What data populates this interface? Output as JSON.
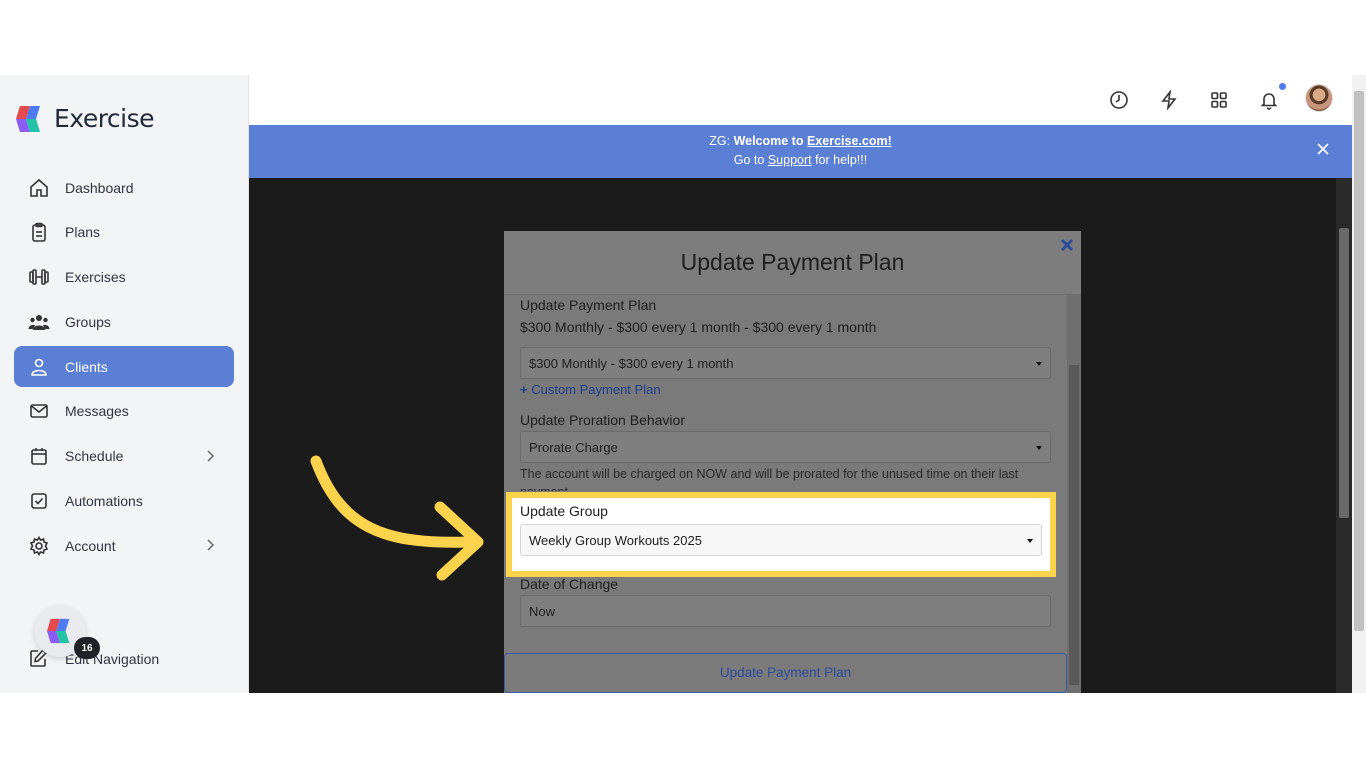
{
  "app": {
    "name": "Exercise"
  },
  "sidebar": {
    "items": [
      {
        "label": "Dashboard",
        "icon": "home-icon"
      },
      {
        "label": "Plans",
        "icon": "clipboard-icon"
      },
      {
        "label": "Exercises",
        "icon": "dumbbell-icon"
      },
      {
        "label": "Groups",
        "icon": "users-icon"
      },
      {
        "label": "Clients",
        "icon": "user-icon",
        "active": true
      },
      {
        "label": "Messages",
        "icon": "mail-icon"
      },
      {
        "label": "Schedule",
        "icon": "calendar-icon",
        "has_submenu": true
      },
      {
        "label": "Automations",
        "icon": "checkbox-icon"
      },
      {
        "label": "Account",
        "icon": "gear-icon",
        "has_submenu": true
      }
    ],
    "edit_nav_label": "Edit Navigation",
    "badge_count": "16"
  },
  "banner": {
    "line1_prefix": "ZG: ",
    "line1_bold": "Welcome to ",
    "line1_link": "Exercise.com!",
    "line2_prefix": "Go to ",
    "line2_link": "Support",
    "line2_suffix": " for help!!!"
  },
  "modal": {
    "title": "Update Payment Plan",
    "plan_label": "Update Payment Plan",
    "current_plan": "$300 Monthly - $300 every 1 month - $300 every 1 month",
    "plan_select_value": "$300 Monthly - $300 every 1 month",
    "custom_plan_link": "Custom Payment Plan",
    "proration_label": "Update Proration Behavior",
    "proration_value": "Prorate Charge",
    "proration_help": "The account will be charged on NOW and will be prorated for the unused time on their last payment",
    "group_label": "Update Group",
    "group_value": "Weekly Group Workouts 2025",
    "date_label": "Date of Change",
    "date_value": "Now",
    "submit_label": "Update Payment Plan"
  },
  "colors": {
    "accent": "#5b7fd4",
    "highlight": "#fcd34d",
    "arrow": "#fcd34d"
  }
}
